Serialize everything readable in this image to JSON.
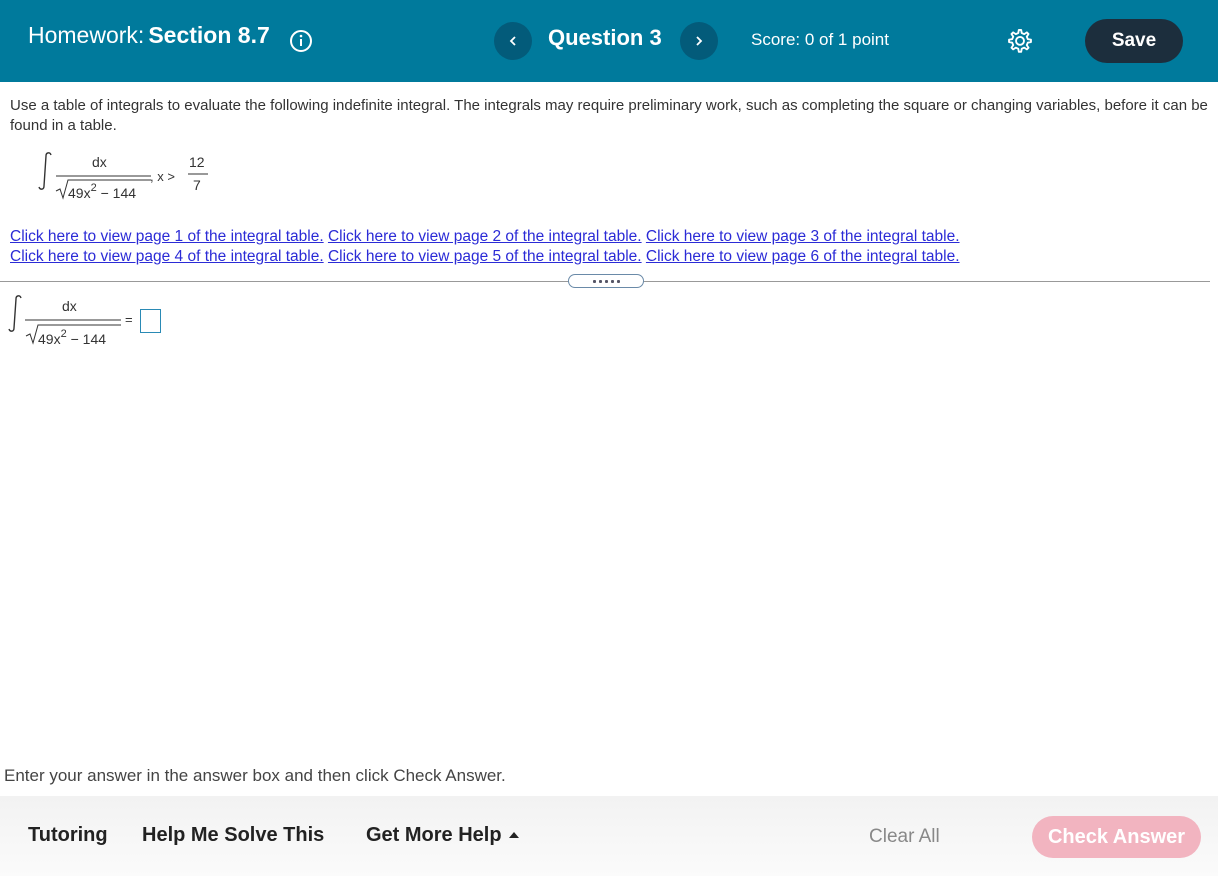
{
  "header": {
    "homework_label": "Homework:",
    "section": "Section 8.7",
    "question": "Question 3",
    "score": "Score: 0 of 1 point",
    "save_label": "Save",
    "prev_icon": "‹",
    "next_icon": "›"
  },
  "question": {
    "instructions": "Use a table of integrals to evaluate the following indefinite integral. The integrals may require preliminary work, such as completing the square or changing variables, before it can be found in a table.",
    "integral": {
      "numerator": "dx",
      "radicand": "49x",
      "exponent": "2",
      "radicand_rest": " − 144",
      "condition_prefix": ", x >",
      "condition_num": "12",
      "condition_den": "7"
    }
  },
  "links": [
    "Click here to view page 1 of the integral table.",
    "Click here to view page 2 of the integral table.",
    "Click here to view page 3 of the integral table.",
    "Click here to view page 4 of the integral table.",
    "Click here to view page 5 of the integral table.",
    "Click here to view page 6 of the integral table."
  ],
  "answer": {
    "numerator": "dx",
    "radicand": "49x",
    "exponent": "2",
    "radicand_rest": " − 144",
    "equals": "="
  },
  "enter_message": "Enter your answer in the answer box and then click Check Answer.",
  "footer": {
    "tutoring": "Tutoring",
    "help_me_solve": "Help Me Solve This",
    "get_more_help": "Get More Help",
    "clear_all": "Clear All",
    "check_answer": "Check Answer"
  },
  "colors": {
    "header_bg": "#007a9c",
    "save_bg": "#1c2e3d",
    "link": "#2b2bd6",
    "check_answer_bg": "#f2b4c0"
  }
}
